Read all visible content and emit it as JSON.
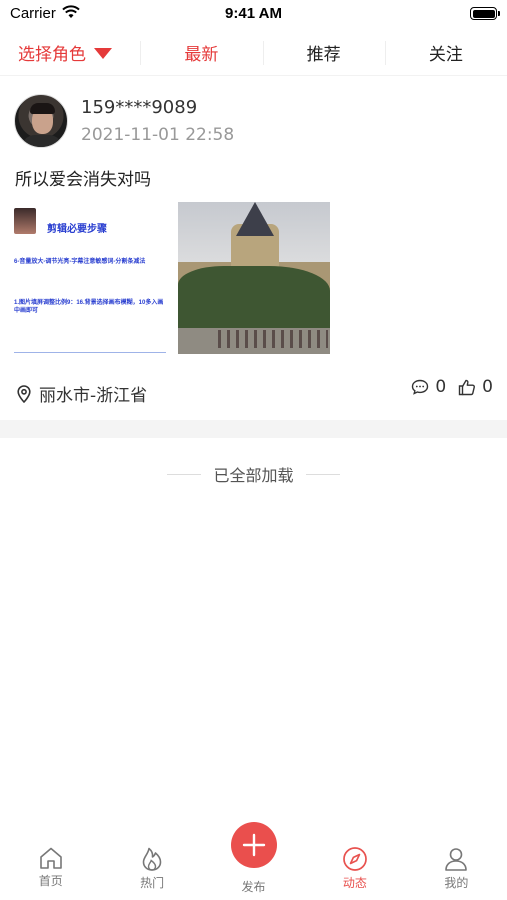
{
  "status_bar": {
    "carrier": "Carrier",
    "time": "9:41 AM"
  },
  "top_tabs": {
    "role_select": "选择角色",
    "tabs": [
      {
        "label": "最新",
        "active": true
      },
      {
        "label": "推荐",
        "active": false
      },
      {
        "label": "关注",
        "active": false
      }
    ]
  },
  "post": {
    "username": "159****9089",
    "timestamp": "2021-11-01 22:58",
    "text": "所以爱会消失对吗",
    "image1": {
      "title": "剪辑必要步骤",
      "line2": "6-音量放大-调节光亮-字幕注意敏感词-分割条减法",
      "line3": "1.图片填屏调整比例9：16.背景选择画布模糊，10多入画中画即可"
    },
    "location": "丽水市-浙江省",
    "comment_count": "0",
    "like_count": "0"
  },
  "footer_text": "已全部加载",
  "bottom_nav": {
    "items": [
      {
        "label": "首页",
        "icon": "home-icon"
      },
      {
        "label": "热门",
        "icon": "flame-icon"
      },
      {
        "label": "发布",
        "icon": "plus-icon"
      },
      {
        "label": "动态",
        "icon": "compass-icon",
        "active": true
      },
      {
        "label": "我的",
        "icon": "user-icon"
      }
    ]
  },
  "colors": {
    "accent": "#e53a3a",
    "muted": "#999999",
    "band": "#f4f4f4"
  }
}
